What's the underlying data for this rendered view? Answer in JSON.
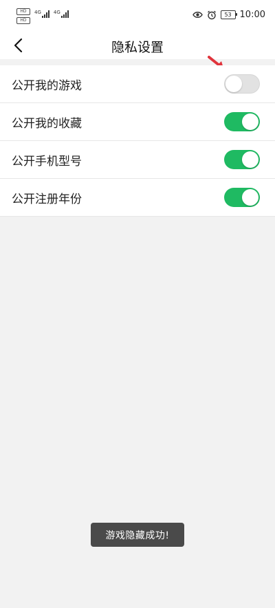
{
  "status_bar": {
    "sim1_label": "HD",
    "sim2_label": "HD",
    "net1_type": "4G",
    "net2_type": "4G",
    "battery_level": "53",
    "time": "10:00",
    "icons": [
      "eye-comfort-icon",
      "alarm-icon"
    ]
  },
  "nav": {
    "back_icon": "chevron-left-icon",
    "title": "隐私设置"
  },
  "settings": {
    "items": [
      {
        "label": "公开我的游戏",
        "enabled": false
      },
      {
        "label": "公开我的收藏",
        "enabled": true
      },
      {
        "label": "公开手机型号",
        "enabled": true
      },
      {
        "label": "公开注册年份",
        "enabled": true
      }
    ]
  },
  "annotation": {
    "icon": "red-arrow-icon",
    "color": "#e0343c"
  },
  "toast": {
    "text": "游戏隐藏成功!"
  },
  "colors": {
    "toggle_on": "#1fba62",
    "toggle_off": "#e2e2e2",
    "background": "#f2f2f2"
  }
}
